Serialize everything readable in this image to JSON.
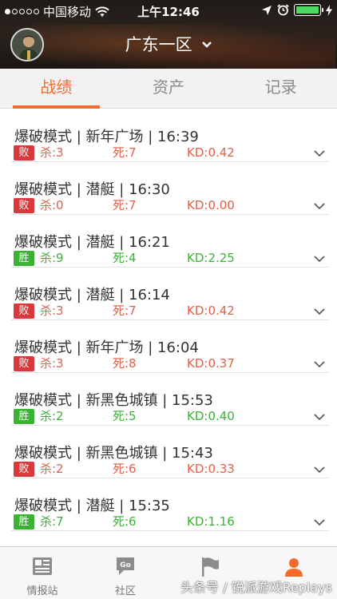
{
  "status_bar": {
    "carrier": "中国移动",
    "time": "上午12:46"
  },
  "header": {
    "server": "广东一区"
  },
  "tabs": [
    {
      "label": "战绩",
      "active": true
    },
    {
      "label": "资产",
      "active": false
    },
    {
      "label": "记录",
      "active": false
    }
  ],
  "matches": [
    {
      "title": "爆破模式 | 新年广场 | 16:39",
      "result": "败",
      "outcome": "lose",
      "kills": "杀:3",
      "deaths": "死:7",
      "kd": "KD:0.42"
    },
    {
      "title": "爆破模式 | 潜艇 | 16:30",
      "result": "败",
      "outcome": "lose",
      "kills": "杀:0",
      "deaths": "死:7",
      "kd": "KD:0.00"
    },
    {
      "title": "爆破模式 | 潜艇 | 16:21",
      "result": "胜",
      "outcome": "win",
      "kills": "杀:9",
      "deaths": "死:4",
      "kd": "KD:2.25"
    },
    {
      "title": "爆破模式 | 潜艇 | 16:14",
      "result": "败",
      "outcome": "lose",
      "kills": "杀:3",
      "deaths": "死:7",
      "kd": "KD:0.42"
    },
    {
      "title": "爆破模式 | 新年广场 | 16:04",
      "result": "败",
      "outcome": "lose",
      "kills": "杀:3",
      "deaths": "死:8",
      "kd": "KD:0.37"
    },
    {
      "title": "爆破模式 | 新黑色城镇 | 15:53",
      "result": "胜",
      "outcome": "win",
      "kills": "杀:2",
      "deaths": "死:5",
      "kd": "KD:0.40"
    },
    {
      "title": "爆破模式 | 新黑色城镇 | 15:43",
      "result": "败",
      "outcome": "lose",
      "kills": "杀:2",
      "deaths": "死:6",
      "kd": "KD:0.33"
    },
    {
      "title": "爆破模式 | 潜艇 | 15:35",
      "result": "胜",
      "outcome": "win",
      "kills": "杀:7",
      "deaths": "死:6",
      "kd": "KD:1.16"
    }
  ],
  "bottom_nav": [
    {
      "label": "情报站",
      "icon": "news-icon",
      "active": false
    },
    {
      "label": "社区",
      "icon": "chat-icon",
      "active": false
    },
    {
      "label": "",
      "icon": "flag-icon",
      "active": false
    },
    {
      "label": "",
      "icon": "profile-icon",
      "active": true
    }
  ],
  "watermark": "头条号 / 锐派游戏Replays",
  "colors": {
    "accent": "#f26b2a",
    "lose": "#d9393a",
    "win": "#3cb235",
    "battery": "#4cd964"
  }
}
